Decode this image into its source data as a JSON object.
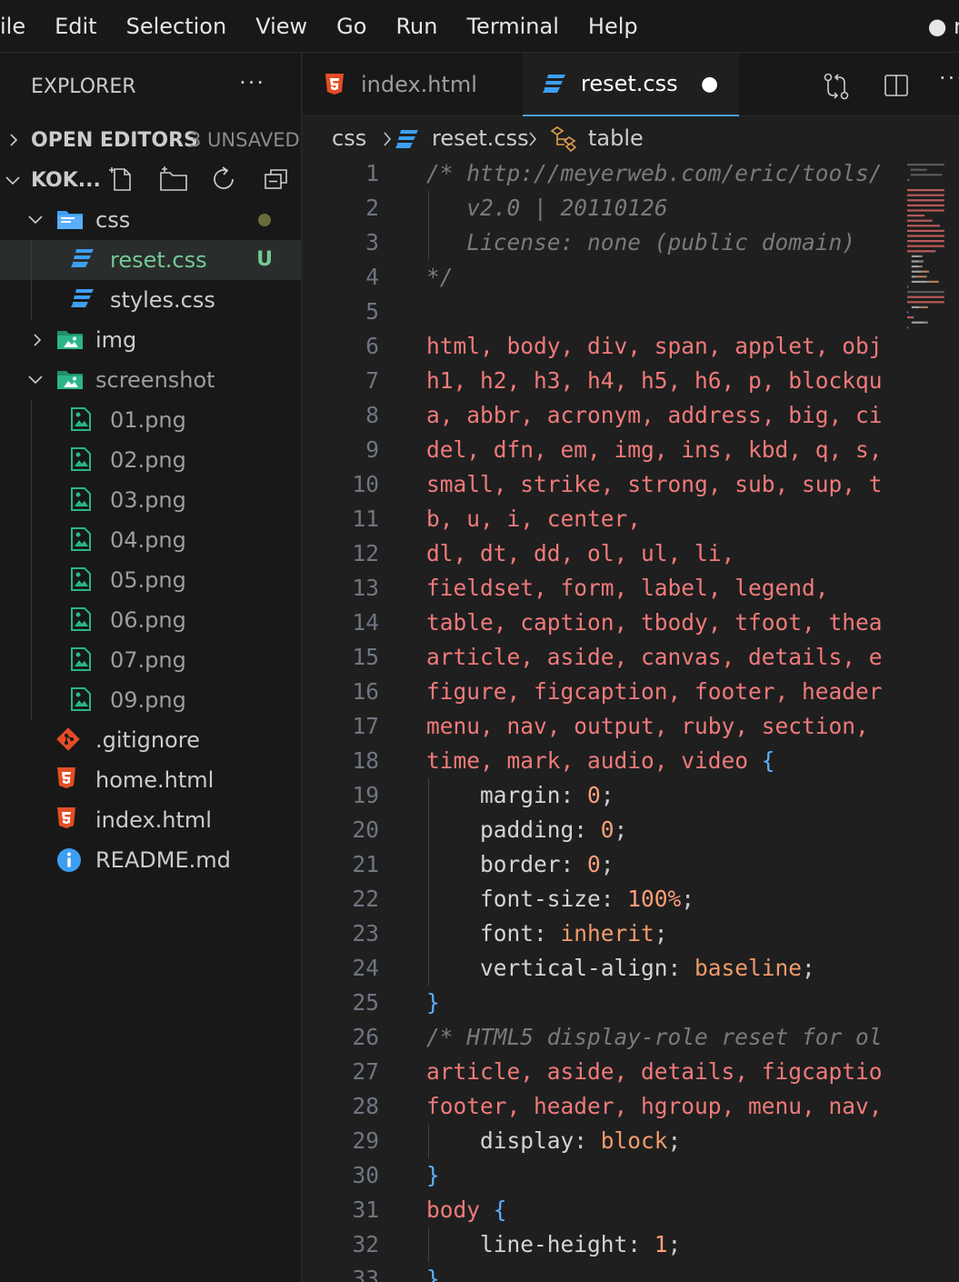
{
  "menubar": {
    "items": [
      "ile",
      "Edit",
      "Selection",
      "View",
      "Go",
      "Run",
      "Terminal",
      "Help"
    ],
    "window_title": "● r"
  },
  "explorer": {
    "title": "EXPLORER",
    "more": "···",
    "open_editors": {
      "label": "OPEN EDITORS",
      "badge": "3 UNSAVED"
    },
    "workspace": {
      "label": "KOK..."
    },
    "tree": [
      {
        "label": "css",
        "kind": "folder",
        "expanded": true,
        "depth": 1,
        "color": "#cccccc",
        "status": "dot"
      },
      {
        "label": "reset.css",
        "kind": "css",
        "depth": 2,
        "color": "#73c991",
        "status": "U",
        "selected": true
      },
      {
        "label": "styles.css",
        "kind": "css",
        "depth": 2,
        "color": "#cccccc"
      },
      {
        "label": "img",
        "kind": "imgfolder",
        "expanded": false,
        "depth": 1,
        "color": "#cccccc"
      },
      {
        "label": "screenshot",
        "kind": "imgfolder",
        "expanded": true,
        "depth": 1,
        "color": "#9d9d9d"
      },
      {
        "label": "01.png",
        "kind": "png",
        "depth": 2,
        "color": "#9d9d9d"
      },
      {
        "label": "02.png",
        "kind": "png",
        "depth": 2,
        "color": "#9d9d9d"
      },
      {
        "label": "03.png",
        "kind": "png",
        "depth": 2,
        "color": "#9d9d9d"
      },
      {
        "label": "04.png",
        "kind": "png",
        "depth": 2,
        "color": "#9d9d9d"
      },
      {
        "label": "05.png",
        "kind": "png",
        "depth": 2,
        "color": "#9d9d9d"
      },
      {
        "label": "06.png",
        "kind": "png",
        "depth": 2,
        "color": "#9d9d9d"
      },
      {
        "label": "07.png",
        "kind": "png",
        "depth": 2,
        "color": "#9d9d9d"
      },
      {
        "label": "09.png",
        "kind": "png",
        "depth": 2,
        "color": "#9d9d9d"
      },
      {
        "label": ".gitignore",
        "kind": "git",
        "depth": 1,
        "color": "#cccccc"
      },
      {
        "label": "home.html",
        "kind": "html",
        "depth": 1,
        "color": "#cccccc"
      },
      {
        "label": "index.html",
        "kind": "html",
        "depth": 1,
        "color": "#cccccc"
      },
      {
        "label": "README.md",
        "kind": "info",
        "depth": 1,
        "color": "#cccccc"
      }
    ]
  },
  "tabs": [
    {
      "label": "index.html",
      "icon": "html5-icon",
      "active": false
    },
    {
      "label": "reset.css",
      "icon": "css3-icon",
      "active": true,
      "dirty_marker": "●"
    }
  ],
  "breadcrumb": {
    "folder": "css",
    "file": "reset.css",
    "symbol": "table"
  },
  "editor": {
    "lines": [
      [
        [
          "/* http://meyerweb.com/eric/tools/",
          "com"
        ]
      ],
      [
        [
          "   v2.0 | 20110126",
          "com"
        ]
      ],
      [
        [
          "   License: none (public domain)",
          "com"
        ]
      ],
      [
        [
          "*/",
          "com"
        ]
      ],
      [],
      [
        [
          "html, body, div, span, applet, obj",
          "sel"
        ]
      ],
      [
        [
          "h1, h2, h3, h4, h5, h6, p, blockqu",
          "sel"
        ]
      ],
      [
        [
          "a, abbr, acronym, address, big, ci",
          "sel"
        ]
      ],
      [
        [
          "del, dfn, em, img, ins, kbd, q, s,",
          "sel"
        ]
      ],
      [
        [
          "small, strike, strong, sub, sup, t",
          "sel"
        ]
      ],
      [
        [
          "b, u, i, center,",
          "sel"
        ]
      ],
      [
        [
          "dl, dt, dd, ol, ul, li,",
          "sel"
        ]
      ],
      [
        [
          "fieldset, form, label, legend,",
          "sel"
        ]
      ],
      [
        [
          "table, caption, tbody, tfoot, thea",
          "sel"
        ]
      ],
      [
        [
          "article, aside, canvas, details, e",
          "sel"
        ]
      ],
      [
        [
          "figure, figcaption, footer, header",
          "sel"
        ]
      ],
      [
        [
          "menu, nav, output, ruby, section, ",
          "sel"
        ]
      ],
      [
        [
          "time, mark, audio, video ",
          "sel"
        ],
        [
          "{",
          "brace"
        ]
      ],
      [
        [
          "    margin",
          "prop"
        ],
        [
          ": ",
          "punct"
        ],
        [
          "0",
          "num"
        ],
        [
          ";",
          "punct"
        ]
      ],
      [
        [
          "    padding",
          "prop"
        ],
        [
          ": ",
          "punct"
        ],
        [
          "0",
          "num"
        ],
        [
          ";",
          "punct"
        ]
      ],
      [
        [
          "    border",
          "prop"
        ],
        [
          ": ",
          "punct"
        ],
        [
          "0",
          "num"
        ],
        [
          ";",
          "punct"
        ]
      ],
      [
        [
          "    font-size",
          "prop"
        ],
        [
          ": ",
          "punct"
        ],
        [
          "100%",
          "num"
        ],
        [
          ";",
          "punct"
        ]
      ],
      [
        [
          "    font",
          "prop"
        ],
        [
          ": ",
          "punct"
        ],
        [
          "inherit",
          "val"
        ],
        [
          ";",
          "punct"
        ]
      ],
      [
        [
          "    vertical-align",
          "prop"
        ],
        [
          ": ",
          "punct"
        ],
        [
          "baseline",
          "val"
        ],
        [
          ";",
          "punct"
        ]
      ],
      [
        [
          "}",
          "brace"
        ]
      ],
      [
        [
          "/* HTML5 display-role reset for ol",
          "com"
        ]
      ],
      [
        [
          "article, aside, details, figcaptio",
          "sel"
        ]
      ],
      [
        [
          "footer, header, hgroup, menu, nav,",
          "sel"
        ]
      ],
      [
        [
          "    display",
          "prop"
        ],
        [
          ": ",
          "punct"
        ],
        [
          "block",
          "val"
        ],
        [
          ";",
          "punct"
        ]
      ],
      [
        [
          "}",
          "brace"
        ]
      ],
      [
        [
          "body ",
          "sel"
        ],
        [
          "{",
          "brace"
        ]
      ],
      [
        [
          "    line-height",
          "prop"
        ],
        [
          ": ",
          "punct"
        ],
        [
          "1",
          "num"
        ],
        [
          ";",
          "punct"
        ]
      ],
      [
        [
          "}",
          "brace"
        ]
      ]
    ],
    "guides": [
      2,
      3,
      19,
      20,
      21,
      22,
      23,
      24,
      29,
      32
    ]
  },
  "colors": {
    "accent": "#4a9fdd",
    "selector": "#f07a7a",
    "comment": "#7a7a7a",
    "number": "#ffa07a",
    "value": "#f09b6a",
    "brace": "#5db0ff",
    "untracked": "#73c991",
    "html_icon": "#e44d26",
    "css_icon": "#3c9ff2",
    "png_icon": "#2bb58a"
  }
}
